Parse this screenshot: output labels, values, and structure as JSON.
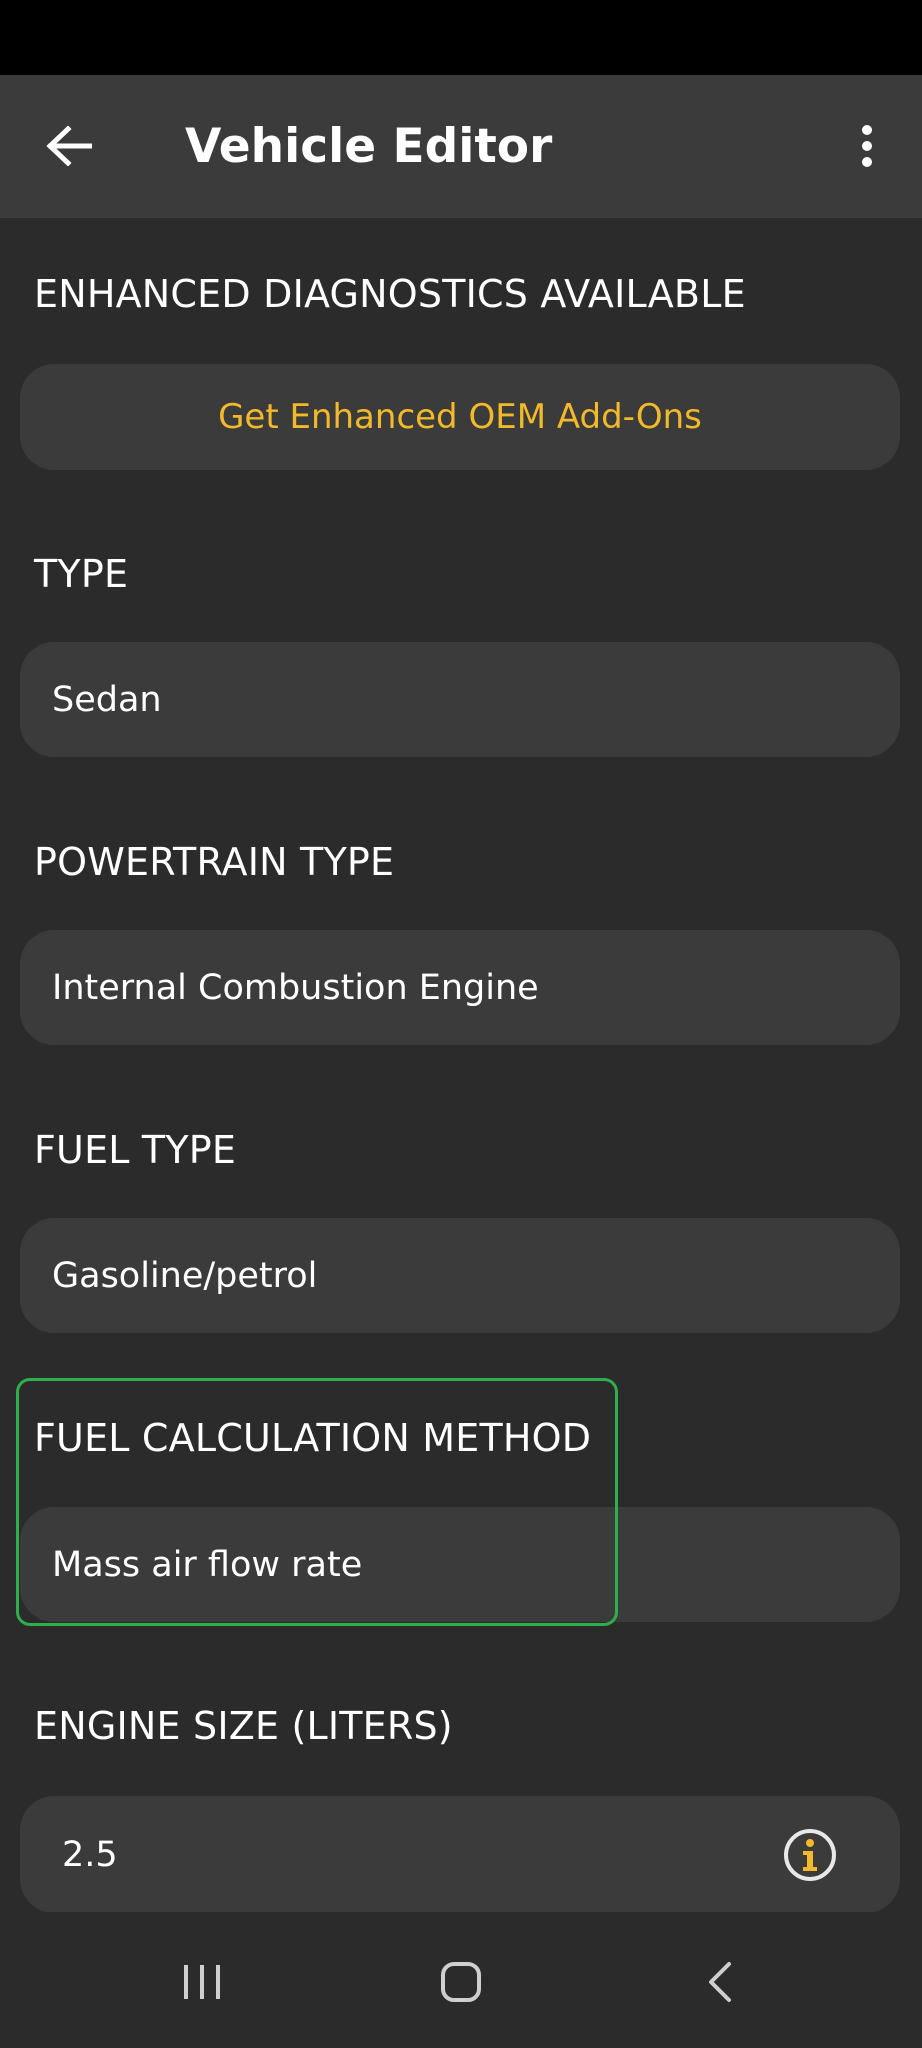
{
  "app_bar": {
    "title": "Vehicle Editor",
    "back_icon": "arrow-left-icon",
    "menu_icon": "more-vert-icon"
  },
  "sections": {
    "enhanced": {
      "label": "ENHANCED DIAGNOSTICS AVAILABLE",
      "button_label": "Get Enhanced OEM Add-Ons"
    },
    "type": {
      "label": "TYPE",
      "value": "Sedan"
    },
    "powertrain": {
      "label": "POWERTRAIN TYPE",
      "value": "Internal Combustion Engine"
    },
    "fuel_type": {
      "label": "FUEL TYPE",
      "value": "Gasoline/petrol"
    },
    "fuel_calc": {
      "label": "FUEL CALCULATION METHOD",
      "value": "Mass air flow rate"
    },
    "engine_size": {
      "label": "ENGINE SIZE (LITERS)",
      "value": "2.5",
      "info_icon": "info-icon"
    }
  },
  "nav_bar": {
    "recents_icon": "recents-icon",
    "home_icon": "home-icon",
    "back_icon": "nav-back-icon"
  },
  "colors": {
    "background": "#2b2b2b",
    "surface": "#3b3b3b",
    "accent": "#f2b92a",
    "highlight": "#2fae4e"
  }
}
